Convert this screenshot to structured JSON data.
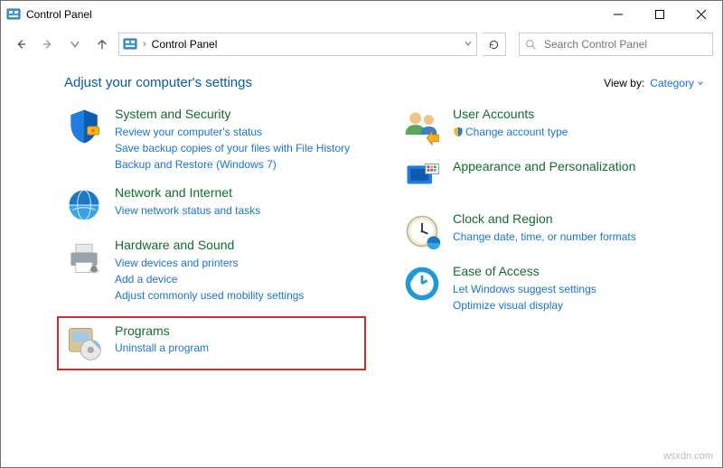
{
  "window_title": "Control Panel",
  "breadcrumb": {
    "root": "Control Panel"
  },
  "search": {
    "placeholder": "Search Control Panel"
  },
  "heading": "Adjust your computer's settings",
  "view_by": {
    "label": "View by:",
    "value": "Category"
  },
  "categories": {
    "system": {
      "title": "System and Security",
      "links": [
        "Review your computer's status",
        "Save backup copies of your files with File History",
        "Backup and Restore (Windows 7)"
      ]
    },
    "network": {
      "title": "Network and Internet",
      "links": [
        "View network status and tasks"
      ]
    },
    "hardware": {
      "title": "Hardware and Sound",
      "links": [
        "View devices and printers",
        "Add a device",
        "Adjust commonly used mobility settings"
      ]
    },
    "programs": {
      "title": "Programs",
      "links": [
        "Uninstall a program"
      ]
    },
    "users": {
      "title": "User Accounts",
      "links": [
        "Change account type"
      ]
    },
    "appearance": {
      "title": "Appearance and Personalization"
    },
    "clock": {
      "title": "Clock and Region",
      "links": [
        "Change date, time, or number formats"
      ]
    },
    "ease": {
      "title": "Ease of Access",
      "links": [
        "Let Windows suggest settings",
        "Optimize visual display"
      ]
    }
  },
  "watermark": "wsxdn.com"
}
